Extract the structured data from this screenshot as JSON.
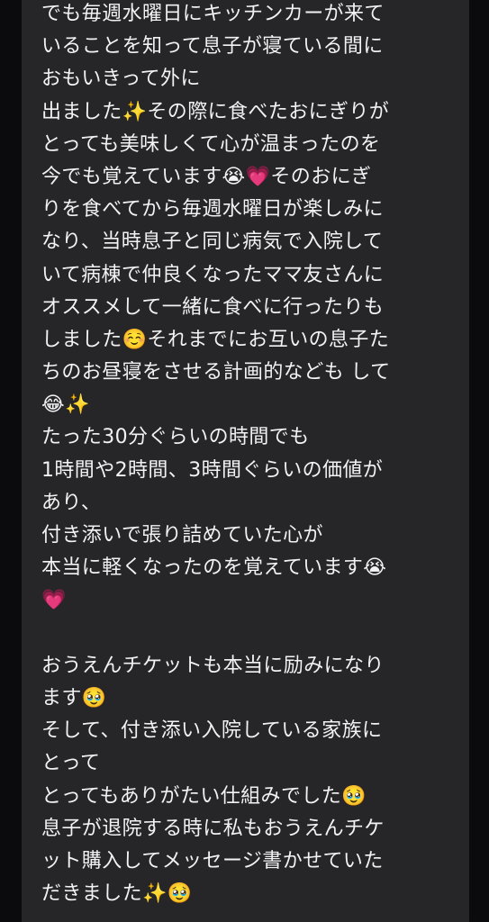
{
  "message": {
    "lines": [
      "でも毎週水曜日にキッチンカーが来て",
      "いることを知って息子が寝ている間に",
      "おもいきって外に",
      "出ました✨その際に食べたおにぎりが",
      "とっても美味しくて心が温まったのを",
      "今でも覚えています😭💗そのおにぎ",
      "りを食べてから毎週水曜日が楽しみに",
      "なり、当時息子と同じ病気で入院して",
      "いて病棟で仲良くなったママ友さんに",
      "オススメして一緒に食べに行ったりも",
      "しました☺️それまでにお互いの息子た",
      "ちのお昼寝をさせる計画的なども して",
      "😂✨",
      "たった30分ぐらいの時間でも",
      "1時間や2時間、3時間ぐらいの価値が",
      "あり、",
      "付き添いで張り詰めていた心が",
      "本当に軽くなったのを覚えています😭",
      "💗",
      "",
      "おうえんチケットも本当に励みになり",
      "ます🥹",
      "そして、付き添い入院している家族に",
      "とって",
      "とってもありがたい仕組みでした🥹",
      "息子が退院する時に私もおうえんチケ",
      "ット購入してメッセージ書かせていた",
      "だきました✨🥹"
    ]
  }
}
